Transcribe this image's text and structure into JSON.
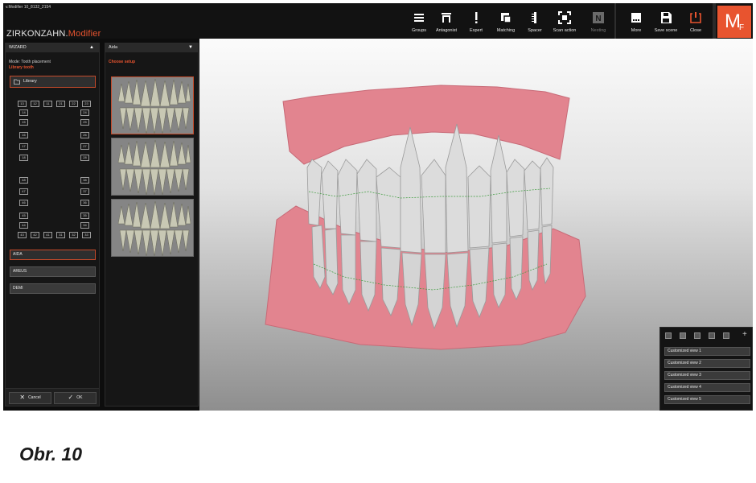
{
  "window": {
    "title": "v.Modifier 10_8132_2154"
  },
  "brand": {
    "name": "ZIRKONZAHN.",
    "accent": "Modifier"
  },
  "toolbar": {
    "items": [
      {
        "label": "Groups",
        "icon": "list-icon"
      },
      {
        "label": "Antagonist",
        "icon": "antagonist-icon"
      },
      {
        "label": "Expert",
        "icon": "exclamation-icon"
      },
      {
        "label": "Matching",
        "icon": "matching-icon"
      },
      {
        "label": "Spacer",
        "icon": "spacer-icon"
      },
      {
        "label": "Scan action",
        "icon": "scan-action-icon"
      },
      {
        "label": "Nesting",
        "icon": "nesting-icon",
        "disabled": true
      },
      {
        "label": "More",
        "icon": "more-icon"
      },
      {
        "label": "Save scene",
        "icon": "save-icon"
      },
      {
        "label": "Close",
        "icon": "power-icon"
      }
    ]
  },
  "logo": {
    "letter": "M",
    "sub": "F"
  },
  "wizard": {
    "header": "WIZARD",
    "mode": "Mode: Tooth placement",
    "title": "Library tooth",
    "library_button": "Library",
    "upper_row": [
      "13",
      "12",
      "11",
      "21",
      "22",
      "23"
    ],
    "upper_left": [
      "14",
      "15",
      "16",
      "17",
      "18"
    ],
    "upper_right": [
      "24",
      "25",
      "26",
      "27",
      "28"
    ],
    "lower_left": [
      "48",
      "47",
      "46",
      "45",
      "44"
    ],
    "lower_right": [
      "38",
      "37",
      "36",
      "35",
      "34"
    ],
    "lower_row": [
      "43",
      "42",
      "41",
      "31",
      "32",
      "33"
    ],
    "setups": [
      "AIDA",
      "AREUS",
      "DEMI"
    ],
    "cancel": "Cancel",
    "ok": "OK"
  },
  "setup_panel": {
    "header": "Aida",
    "title": "Choose setup"
  },
  "views": {
    "items": [
      "Customized view 1",
      "Customized view 2",
      "Customized view 3",
      "Customized view 4",
      "Customized view 5"
    ]
  },
  "caption": "Obr. 10",
  "colors": {
    "accent": "#e8542f",
    "gum": "#e2848f",
    "tooth": "#dcdcdc"
  }
}
